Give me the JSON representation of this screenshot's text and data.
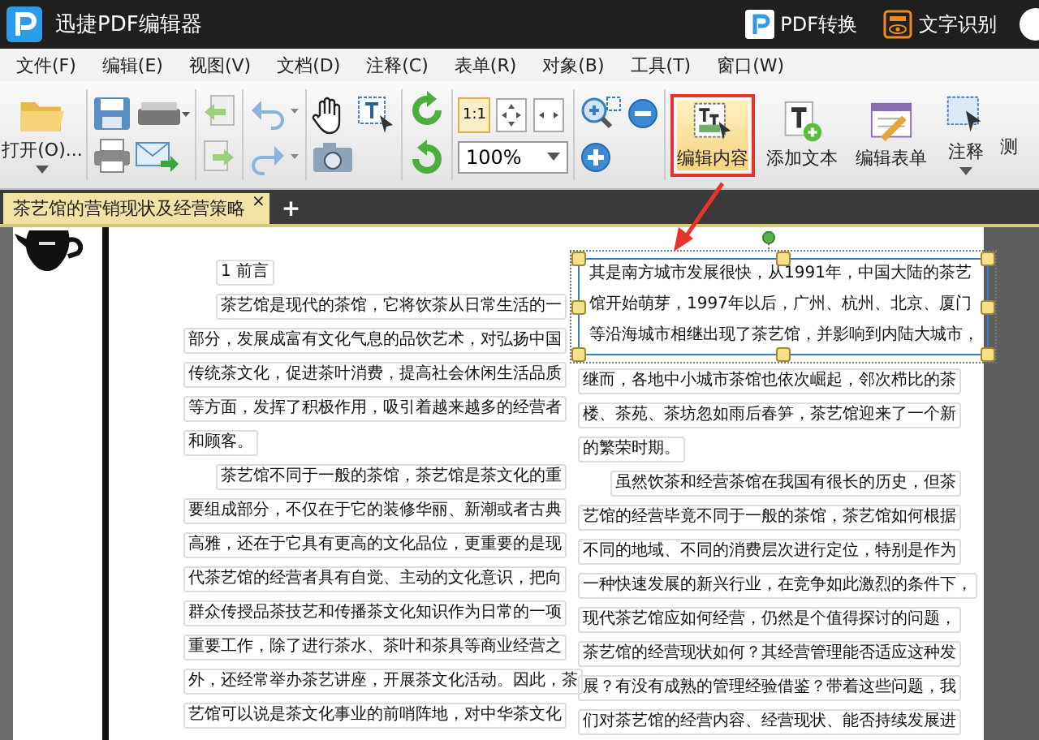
{
  "app": {
    "title": "迅捷PDF编辑器"
  },
  "header_actions": [
    {
      "kind": "pdf",
      "label": "PDF转换"
    },
    {
      "kind": "ocr",
      "label": "文字识别"
    }
  ],
  "menu": [
    "文件(F)",
    "编辑(E)",
    "视图(V)",
    "文档(D)",
    "注释(C)",
    "表单(R)",
    "对象(B)",
    "工具(T)",
    "窗口(W)"
  ],
  "toolbar": {
    "open_label": "打开(O)...",
    "actual_size": "1:1",
    "zoom": "100%",
    "tools": [
      {
        "kind": "edit",
        "label": "编辑内容",
        "selected": true,
        "highlighted": true
      },
      {
        "kind": "text",
        "label": "添加文本",
        "selected": false,
        "highlighted": false
      },
      {
        "kind": "form",
        "label": "编辑表单",
        "selected": false,
        "highlighted": false
      },
      {
        "kind": "note",
        "label": "注释",
        "selected": false,
        "highlighted": false
      }
    ],
    "cut_label": "测"
  },
  "tabs": [
    {
      "label": "茶艺馆的营销现状及经营策略",
      "close": "×",
      "selected": true
    }
  ],
  "new_tab": "+",
  "document": {
    "left_column": [
      {
        "kind": "heading",
        "text": "1 前言"
      },
      {
        "kind": "start",
        "text": "茶艺馆是现代的茶馆，它将饮茶从日常生活的一"
      },
      {
        "kind": "line",
        "text": "部分，发展成富有文化气息的品饮艺术，对弘扬中国"
      },
      {
        "kind": "line",
        "text": "传统茶文化，促进茶叶消费，提高社会休闲生活品质"
      },
      {
        "kind": "line",
        "text": "等方面，发挥了积极作用，吸引着越来越多的经营者"
      },
      {
        "kind": "line",
        "text": "和顾客。"
      },
      {
        "kind": "start",
        "text": "茶艺馆不同于一般的茶馆，茶艺馆是茶文化的重"
      },
      {
        "kind": "line",
        "text": "要组成部分，不仅在于它的装修华丽、新潮或者古典"
      },
      {
        "kind": "line",
        "text": "高雅，还在于它具有更高的文化品位，更重要的是现"
      },
      {
        "kind": "line",
        "text": "代茶艺馆的经营者具有自觉、主动的文化意识，把向"
      },
      {
        "kind": "line",
        "text": "群众传授品茶技艺和传播茶文化知识作为日常的一项"
      },
      {
        "kind": "line",
        "text": "重要工作，除了进行茶水、茶叶和茶具等商业经营之"
      },
      {
        "kind": "line",
        "text": "外，还经常举办茶艺讲座，开展茶文化活动。因此，茶"
      },
      {
        "kind": "line",
        "text": "艺馆可以说是茶文化事业的前哨阵地，对中华茶文化"
      }
    ],
    "right_column": {
      "selected_block": [
        "其是南方城市发展很快，从1991年，中国大陆的茶艺",
        "馆开始萌芽，1997年以后，广州、杭州、北京、厦门",
        "等沿海城市相继出现了茶艺馆，并影响到内陆大城市，"
      ],
      "lines": [
        {
          "kind": "line",
          "text": "继而，各地中小城市茶馆也依次崛起，邻次栉比的茶"
        },
        {
          "kind": "line",
          "text": "楼、茶苑、茶坊忽如雨后春笋，茶艺馆迎来了一个新"
        },
        {
          "kind": "line",
          "text": "的繁荣时期。"
        },
        {
          "kind": "start",
          "text": "虽然饮茶和经营茶馆在我国有很长的历史，但茶"
        },
        {
          "kind": "line",
          "text": "艺馆的经营毕竟不同于一般的茶馆，茶艺馆如何根据"
        },
        {
          "kind": "line",
          "text": "不同的地域、不同的消费层次进行定位，特别是作为"
        },
        {
          "kind": "line",
          "text": "一种快速发展的新兴行业，在竞争如此激烈的条件下，"
        },
        {
          "kind": "line",
          "text": "现代茶艺馆应如何经营，仍然是个值得探讨的问题，"
        },
        {
          "kind": "line",
          "text": "茶艺馆的经营现状如何？其经营管理能否适应这种发"
        },
        {
          "kind": "line",
          "text": "展？有没有成熟的管理经验借鉴？带着这些问题，我"
        },
        {
          "kind": "line",
          "text": "们对茶艺馆的经营内容、经营现状、能否持续发展进"
        }
      ]
    }
  }
}
